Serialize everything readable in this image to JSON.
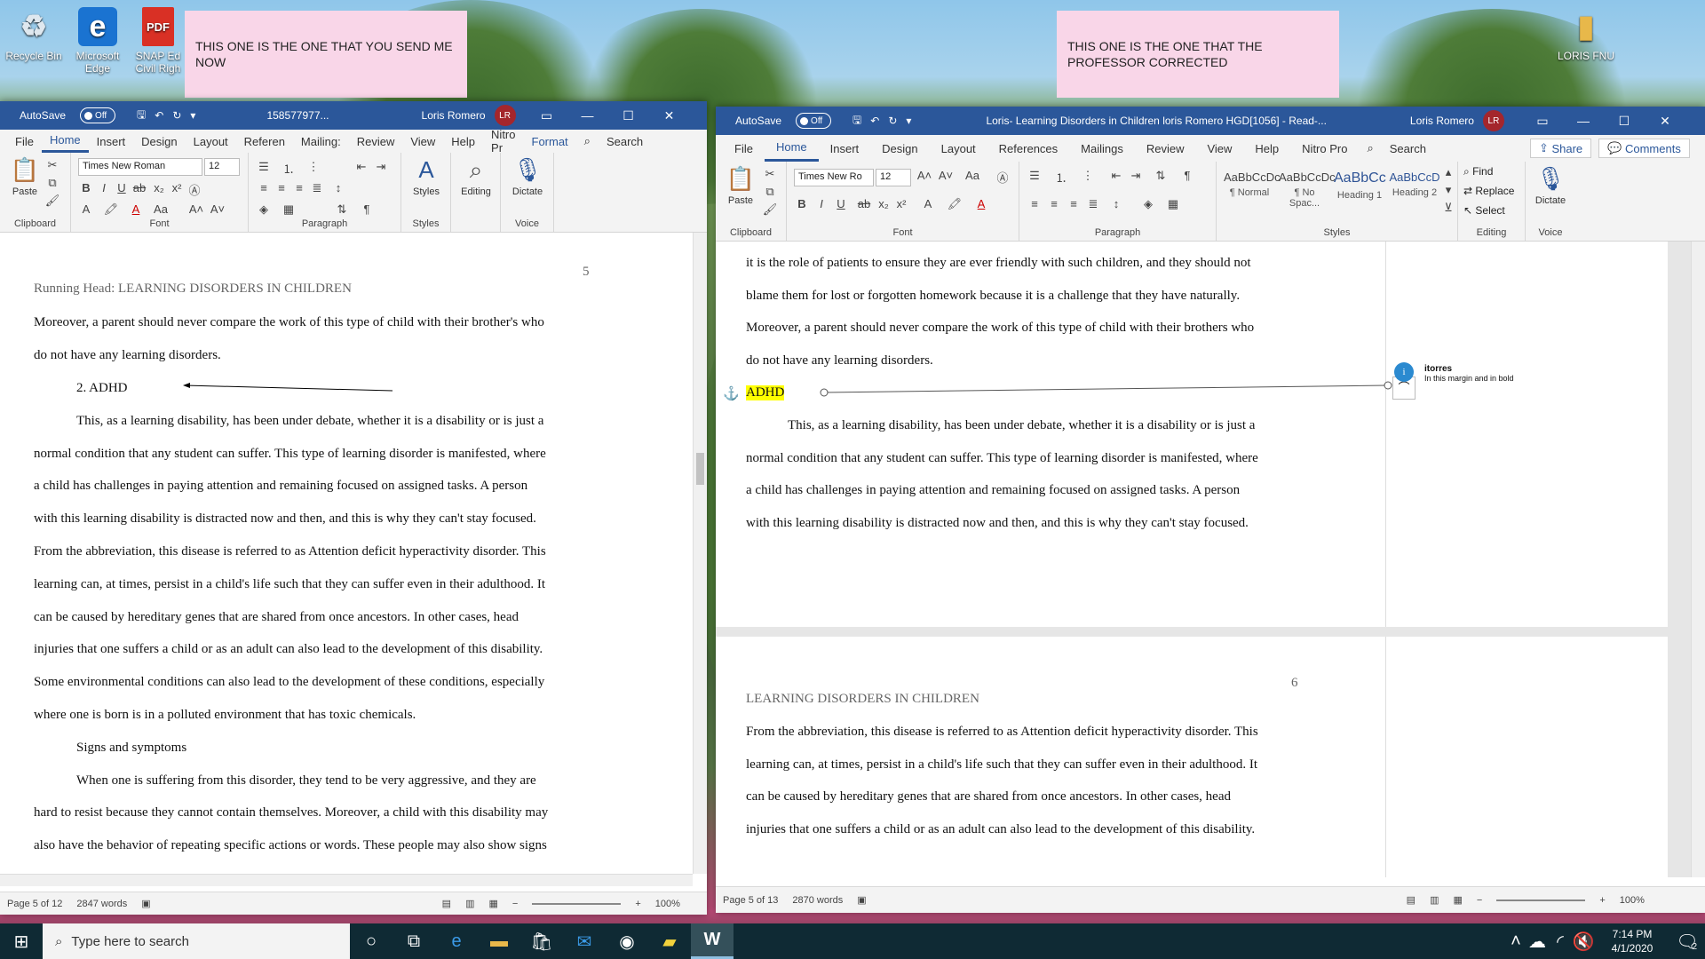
{
  "desktop": {
    "icons": [
      {
        "label": "Recycle Bin",
        "icon": "recycle-bin-icon"
      },
      {
        "label": "Microsoft Edge",
        "icon": "edge-icon"
      },
      {
        "label": "SNAP Ed Civil Righ",
        "icon": "pdf-icon",
        "badge": "PDF"
      },
      {
        "label": "LORIS FNU",
        "icon": "folder-icon"
      }
    ],
    "notes": [
      "THIS ONE IS THE ONE THAT YOU SEND ME NOW",
      "THIS ONE IS THE ONE THAT THE PROFESSOR CORRECTED"
    ]
  },
  "left_window": {
    "autosave_label": "AutoSave",
    "autosave_state": "Off",
    "doc_title": "158577977...",
    "user": "Loris Romero",
    "user_initials": "LR",
    "tabs": [
      "File",
      "Home",
      "Insert",
      "Design",
      "Layout",
      "Referen",
      "Mailing:",
      "Review",
      "View",
      "Help",
      "Nitro Pr",
      "Format"
    ],
    "active_tab": "Home",
    "search": "Search",
    "font_name": "Times New Roman",
    "font_size": "12",
    "ribbon_groups": [
      "Clipboard",
      "Font",
      "Paragraph",
      "Styles",
      "Voice"
    ],
    "buttons": {
      "paste": "Paste",
      "styles": "Styles",
      "editing": "Editing",
      "dictate": "Dictate"
    },
    "page": {
      "number": "5",
      "header": "Running Head: LEARNING DISORDERS IN CHILDREN",
      "lines": [
        "Moreover, a parent should never compare the work of this type of child with their brother's who",
        "do not have any learning disorders.",
        "2.   ADHD",
        "This, as a learning disability, has been under debate, whether it is a disability or is just a",
        "normal condition that any student can suffer. This type of learning disorder is manifested, where",
        "a child has challenges in paying attention and remaining focused on assigned tasks. A person",
        "with this learning disability is distracted now and then, and this is why they can't stay focused.",
        "From the abbreviation, this disease is referred to as Attention deficit hyperactivity disorder. This",
        "learning can, at times, persist in a child's life such that they can suffer even in their adulthood. It",
        "can be caused by hereditary genes that are shared from once ancestors. In other cases, head",
        "injuries that one suffers a child or as an adult can also lead to the development of this disability.",
        "Some environmental conditions can also lead to the development of these conditions, especially",
        "where one is born is in a polluted environment that has toxic chemicals.",
        "Signs and symptoms",
        "When one is suffering from this disorder, they tend to be very aggressive, and they are",
        "hard to resist because they cannot contain themselves. Moreover, a child with this disability may",
        "also have the behavior of repeating specific actions or words. These people may also show signs"
      ]
    },
    "status": {
      "page": "Page 5 of 12",
      "words": "2847 words",
      "zoom": "100%"
    }
  },
  "right_window": {
    "autosave_label": "AutoSave",
    "autosave_state": "Off",
    "doc_title": "Loris- Learning Disorders in Children loris Romero HGD[1056]  -  Read-...",
    "user": "Loris Romero",
    "user_initials": "LR",
    "tabs": [
      "File",
      "Home",
      "Insert",
      "Design",
      "Layout",
      "References",
      "Mailings",
      "Review",
      "View",
      "Help",
      "Nitro Pro"
    ],
    "active_tab": "Home",
    "search": "Search",
    "share": "Share",
    "comments": "Comments",
    "font_name": "Times New Ro",
    "font_size": "12",
    "ribbon_groups": [
      "Clipboard",
      "Font",
      "Paragraph",
      "Styles",
      "Editing",
      "Voice"
    ],
    "styles": [
      {
        "preview": "AaBbCcDc",
        "name": "¶ Normal"
      },
      {
        "preview": "AaBbCcDc",
        "name": "¶ No Spac..."
      },
      {
        "preview": "AaBbCc",
        "name": "Heading 1"
      },
      {
        "preview": "AaBbCcD",
        "name": "Heading 2"
      }
    ],
    "editing": {
      "find": "Find",
      "replace": "Replace",
      "select": "Select"
    },
    "buttons": {
      "paste": "Paste",
      "dictate": "Dictate"
    },
    "page_top": {
      "lines": [
        "it is the role of patients to ensure they are ever friendly with such children, and they should not",
        "blame them for lost or forgotten homework because it is a challenge that they have naturally.",
        "Moreover, a parent should never compare the work of this type of child with their brothers who",
        "do not have any learning disorders.",
        "ADHD",
        "This, as a learning disability, has been under debate, whether it is a disability or is just a",
        "normal condition that any student can suffer. This type of learning disorder is manifested, where",
        "a child has challenges in paying attention and remaining focused on assigned tasks. A person",
        "with this learning disability is distracted now and then, and this is why they can't stay focused."
      ]
    },
    "comment": {
      "author": "itorres",
      "text": "In this margin and in bold"
    },
    "page_next": {
      "number": "6",
      "header": "LEARNING DISORDERS IN CHILDREN",
      "lines": [
        "From the abbreviation, this disease is referred to as Attention deficit hyperactivity disorder. This",
        "learning can, at times, persist in a child's life such that they can suffer even in their adulthood. It",
        "can be caused by hereditary genes that are shared from once ancestors. In other cases, head",
        "injuries that one suffers a child or as an adult can also lead to the development of this disability."
      ]
    },
    "status": {
      "page": "Page 5 of 13",
      "words": "2870 words",
      "zoom": "100%"
    }
  },
  "taskbar": {
    "search_placeholder": "Type here to search",
    "time": "7:14 PM",
    "date": "4/1/2020",
    "notification_count": "2"
  },
  "colors": {
    "word_blue": "#2b579a",
    "highlight": "#ffff00",
    "note_pink": "#f9d6e8"
  }
}
